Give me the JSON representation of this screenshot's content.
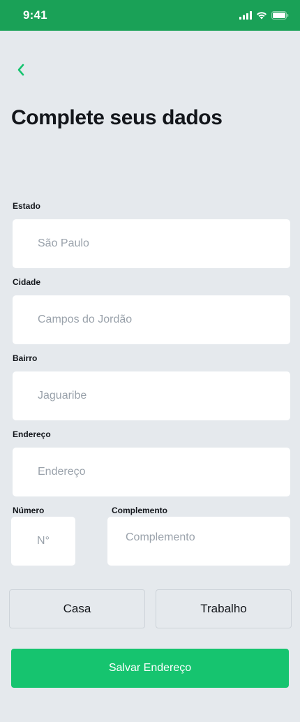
{
  "status_bar": {
    "time": "9:41",
    "icons": [
      "signal-icon",
      "wifi-icon",
      "battery-icon"
    ],
    "background": "#1aa157"
  },
  "header": {
    "back_icon": "chevron-left-icon",
    "title": "Complete seus dados",
    "accent": "#16c46f"
  },
  "form": {
    "estado": {
      "label": "Estado",
      "placeholder": "São Paulo"
    },
    "cidade": {
      "label": "Cidade",
      "placeholder": "Campos do Jordão"
    },
    "bairro": {
      "label": "Bairro",
      "placeholder": "Jaguaribe"
    },
    "endereco": {
      "label": "Endereço",
      "placeholder": "Endereço"
    },
    "numero": {
      "label": "Número",
      "placeholder": "N°"
    },
    "complemento": {
      "label": "Complemento",
      "placeholder": "Complemento"
    }
  },
  "address_type": {
    "options": [
      "Casa",
      "Trabalho"
    ]
  },
  "save_label": "Salvar Endereço"
}
